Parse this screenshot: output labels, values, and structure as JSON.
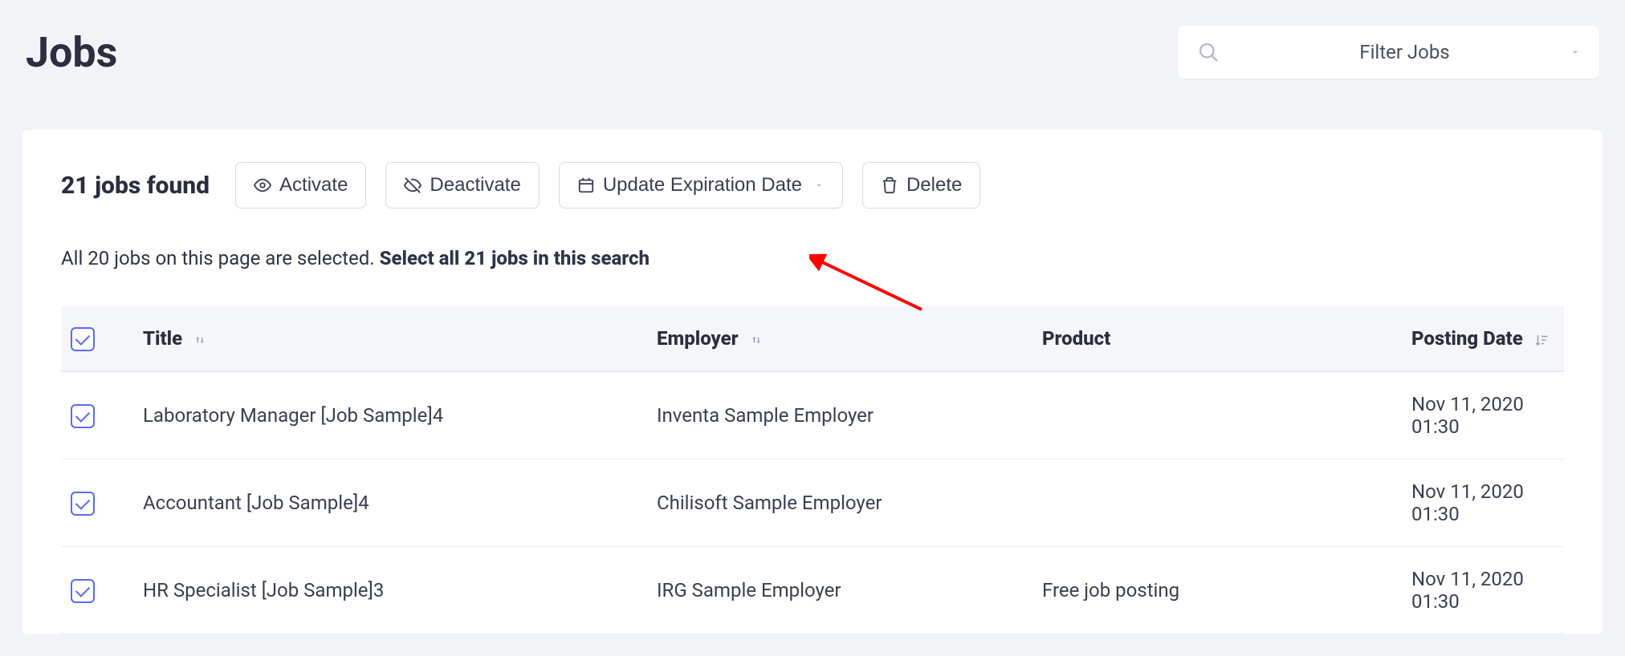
{
  "header": {
    "title": "Jobs",
    "filter_label": "Filter Jobs"
  },
  "toolbar": {
    "found_label": "21 jobs found",
    "activate_label": "Activate",
    "deactivate_label": "Deactivate",
    "update_exp_label": "Update Expiration Date",
    "delete_label": "Delete"
  },
  "selection": {
    "msg_prefix": "All 20 jobs on this page are selected. ",
    "select_all_link": "Select all 21 jobs in this search"
  },
  "table": {
    "headers": {
      "title": "Title",
      "employer": "Employer",
      "product": "Product",
      "posting_date": "Posting Date"
    },
    "rows": [
      {
        "title": "Laboratory Manager [Job Sample]4",
        "employer": "Inventa Sample Employer",
        "product": "",
        "posting_date": "Nov 11, 2020 01:30"
      },
      {
        "title": "Accountant [Job Sample]4",
        "employer": "Chilisoft Sample Employer",
        "product": "",
        "posting_date": "Nov 11, 2020 01:30"
      },
      {
        "title": "HR Specialist [Job Sample]3",
        "employer": "IRG Sample Employer",
        "product": "Free job posting",
        "posting_date": "Nov 11, 2020 01:30"
      }
    ]
  }
}
